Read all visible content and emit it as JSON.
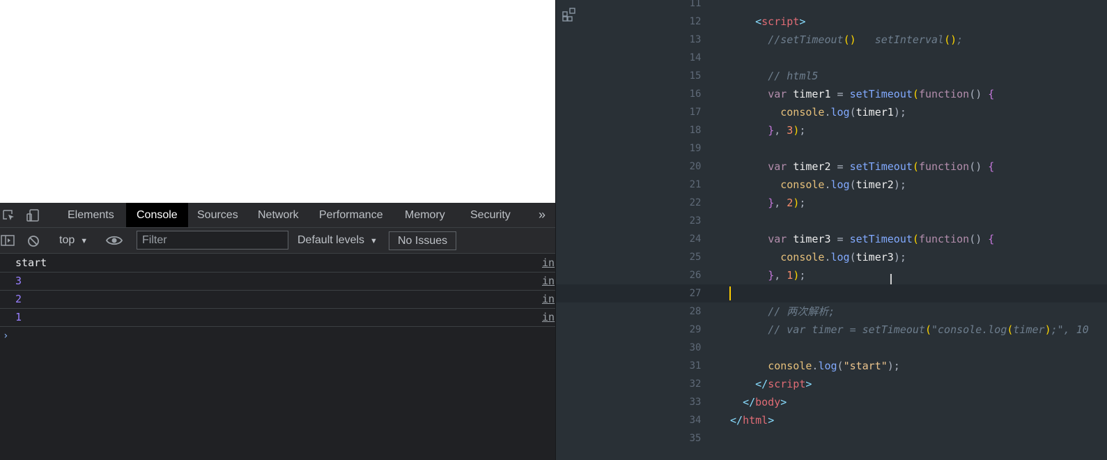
{
  "devtools": {
    "tabs": [
      {
        "label": "Elements",
        "active": false
      },
      {
        "label": "Console",
        "active": true
      },
      {
        "label": "Sources",
        "active": false
      },
      {
        "label": "Network",
        "active": false
      },
      {
        "label": "Performance",
        "active": false
      },
      {
        "label": "Memory",
        "active": false
      },
      {
        "label": "Security",
        "active": false
      }
    ],
    "more_tabs_label": "»",
    "toolbar": {
      "context": "top",
      "filter_placeholder": "Filter",
      "levels": "Default levels",
      "issues": "No Issues"
    },
    "console": {
      "messages": [
        {
          "text": "start",
          "color": "#e8eaed",
          "source": "in"
        },
        {
          "text": "3",
          "color": "#9980ff",
          "source": "in"
        },
        {
          "text": "2",
          "color": "#9980ff",
          "source": "in"
        },
        {
          "text": "1",
          "color": "#9980ff",
          "source": "in"
        }
      ],
      "prompt": "›"
    }
  },
  "editor": {
    "mouse_cursor": "I",
    "lines": [
      {
        "num": "11",
        "current": false,
        "tokens": []
      },
      {
        "num": "12",
        "current": false,
        "tokens": [
          {
            "t": "    ",
            "c": "default"
          },
          {
            "t": "<",
            "c": "bracket"
          },
          {
            "t": "script",
            "c": "tag"
          },
          {
            "t": ">",
            "c": "bracket"
          }
        ]
      },
      {
        "num": "13",
        "current": false,
        "tokens": [
          {
            "t": "      ",
            "c": "default"
          },
          {
            "t": "//setTimeout",
            "c": "comment"
          },
          {
            "t": "()",
            "c": "paren"
          },
          {
            "t": "   setInterval",
            "c": "comment"
          },
          {
            "t": "()",
            "c": "paren"
          },
          {
            "t": ";",
            "c": "comment"
          }
        ]
      },
      {
        "num": "14",
        "current": false,
        "tokens": []
      },
      {
        "num": "15",
        "current": false,
        "tokens": [
          {
            "t": "      ",
            "c": "default"
          },
          {
            "t": "// html5",
            "c": "comment"
          }
        ]
      },
      {
        "num": "16",
        "current": false,
        "tokens": [
          {
            "t": "      ",
            "c": "default"
          },
          {
            "t": "var",
            "c": "keyword"
          },
          {
            "t": " ",
            "c": "default"
          },
          {
            "t": "timer1",
            "c": "ident"
          },
          {
            "t": " = ",
            "c": "punct"
          },
          {
            "t": "setTimeout",
            "c": "func"
          },
          {
            "t": "(",
            "c": "paren"
          },
          {
            "t": "function",
            "c": "keyword"
          },
          {
            "t": "() ",
            "c": "punct"
          },
          {
            "t": "{",
            "c": "brace"
          }
        ]
      },
      {
        "num": "17",
        "current": false,
        "tokens": [
          {
            "t": "        ",
            "c": "default"
          },
          {
            "t": "console",
            "c": "var"
          },
          {
            "t": ".",
            "c": "punct"
          },
          {
            "t": "log",
            "c": "func"
          },
          {
            "t": "(",
            "c": "punct"
          },
          {
            "t": "timer1",
            "c": "ident"
          },
          {
            "t": ");",
            "c": "punct"
          }
        ]
      },
      {
        "num": "18",
        "current": false,
        "tokens": [
          {
            "t": "      ",
            "c": "default"
          },
          {
            "t": "}",
            "c": "brace"
          },
          {
            "t": ", ",
            "c": "punct"
          },
          {
            "t": "3",
            "c": "number"
          },
          {
            "t": ")",
            "c": "paren"
          },
          {
            "t": ";",
            "c": "punct"
          }
        ]
      },
      {
        "num": "19",
        "current": false,
        "tokens": []
      },
      {
        "num": "20",
        "current": false,
        "tokens": [
          {
            "t": "      ",
            "c": "default"
          },
          {
            "t": "var",
            "c": "keyword"
          },
          {
            "t": " ",
            "c": "default"
          },
          {
            "t": "timer2",
            "c": "ident"
          },
          {
            "t": " = ",
            "c": "punct"
          },
          {
            "t": "setTimeout",
            "c": "func"
          },
          {
            "t": "(",
            "c": "paren"
          },
          {
            "t": "function",
            "c": "keyword"
          },
          {
            "t": "() ",
            "c": "punct"
          },
          {
            "t": "{",
            "c": "brace"
          }
        ]
      },
      {
        "num": "21",
        "current": false,
        "tokens": [
          {
            "t": "        ",
            "c": "default"
          },
          {
            "t": "console",
            "c": "var"
          },
          {
            "t": ".",
            "c": "punct"
          },
          {
            "t": "log",
            "c": "func"
          },
          {
            "t": "(",
            "c": "punct"
          },
          {
            "t": "timer2",
            "c": "ident"
          },
          {
            "t": ");",
            "c": "punct"
          }
        ]
      },
      {
        "num": "22",
        "current": false,
        "tokens": [
          {
            "t": "      ",
            "c": "default"
          },
          {
            "t": "}",
            "c": "brace"
          },
          {
            "t": ", ",
            "c": "punct"
          },
          {
            "t": "2",
            "c": "number"
          },
          {
            "t": ")",
            "c": "paren"
          },
          {
            "t": ";",
            "c": "punct"
          }
        ]
      },
      {
        "num": "23",
        "current": false,
        "tokens": []
      },
      {
        "num": "24",
        "current": false,
        "tokens": [
          {
            "t": "      ",
            "c": "default"
          },
          {
            "t": "var",
            "c": "keyword"
          },
          {
            "t": " ",
            "c": "default"
          },
          {
            "t": "timer3",
            "c": "ident"
          },
          {
            "t": " = ",
            "c": "punct"
          },
          {
            "t": "setTimeout",
            "c": "func"
          },
          {
            "t": "(",
            "c": "paren"
          },
          {
            "t": "function",
            "c": "keyword"
          },
          {
            "t": "() ",
            "c": "punct"
          },
          {
            "t": "{",
            "c": "brace"
          }
        ]
      },
      {
        "num": "25",
        "current": false,
        "tokens": [
          {
            "t": "        ",
            "c": "default"
          },
          {
            "t": "console",
            "c": "var"
          },
          {
            "t": ".",
            "c": "punct"
          },
          {
            "t": "log",
            "c": "func"
          },
          {
            "t": "(",
            "c": "punct"
          },
          {
            "t": "timer3",
            "c": "ident"
          },
          {
            "t": ");",
            "c": "punct"
          }
        ]
      },
      {
        "num": "26",
        "current": false,
        "tokens": [
          {
            "t": "      ",
            "c": "default"
          },
          {
            "t": "}",
            "c": "brace"
          },
          {
            "t": ", ",
            "c": "punct"
          },
          {
            "t": "1",
            "c": "number"
          },
          {
            "t": ")",
            "c": "paren"
          },
          {
            "t": ";",
            "c": "punct"
          }
        ]
      },
      {
        "num": "27",
        "current": true,
        "tokens": []
      },
      {
        "num": "28",
        "current": false,
        "tokens": [
          {
            "t": "      ",
            "c": "default"
          },
          {
            "t": "// 两次解析;",
            "c": "comment"
          }
        ]
      },
      {
        "num": "29",
        "current": false,
        "tokens": [
          {
            "t": "      ",
            "c": "default"
          },
          {
            "t": "// var timer = setTimeout",
            "c": "comment"
          },
          {
            "t": "(",
            "c": "paren"
          },
          {
            "t": "\"console.log",
            "c": "comment"
          },
          {
            "t": "(",
            "c": "paren"
          },
          {
            "t": "timer",
            "c": "comment"
          },
          {
            "t": ")",
            "c": "paren"
          },
          {
            "t": ";\", 10",
            "c": "comment"
          }
        ]
      },
      {
        "num": "30",
        "current": false,
        "tokens": []
      },
      {
        "num": "31",
        "current": false,
        "tokens": [
          {
            "t": "      ",
            "c": "default"
          },
          {
            "t": "console",
            "c": "var"
          },
          {
            "t": ".",
            "c": "punct"
          },
          {
            "t": "log",
            "c": "func"
          },
          {
            "t": "(",
            "c": "punct"
          },
          {
            "t": "\"start\"",
            "c": "string"
          },
          {
            "t": ");",
            "c": "punct"
          }
        ]
      },
      {
        "num": "32",
        "current": false,
        "tokens": [
          {
            "t": "    ",
            "c": "default"
          },
          {
            "t": "</",
            "c": "bracket"
          },
          {
            "t": "script",
            "c": "tag"
          },
          {
            "t": ">",
            "c": "bracket"
          }
        ]
      },
      {
        "num": "33",
        "current": false,
        "tokens": [
          {
            "t": "  ",
            "c": "default"
          },
          {
            "t": "</",
            "c": "bracket"
          },
          {
            "t": "body",
            "c": "tag"
          },
          {
            "t": ">",
            "c": "bracket"
          }
        ]
      },
      {
        "num": "34",
        "current": false,
        "tokens": [
          {
            "t": "</",
            "c": "bracket"
          },
          {
            "t": "html",
            "c": "tag"
          },
          {
            "t": ">",
            "c": "bracket"
          }
        ]
      },
      {
        "num": "35",
        "current": false,
        "tokens": []
      }
    ]
  }
}
